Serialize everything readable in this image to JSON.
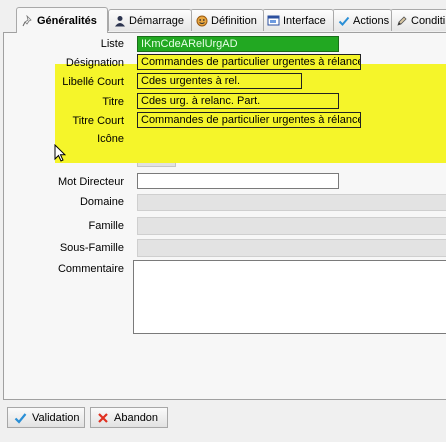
{
  "tabs": [
    {
      "label": "Généralités",
      "icon": "pushpin-icon",
      "active": true
    },
    {
      "label": "Démarrage",
      "icon": "person-icon",
      "active": false
    },
    {
      "label": "Définition",
      "icon": "face-icon",
      "active": false
    },
    {
      "label": "Interface",
      "icon": "window-icon",
      "active": false
    },
    {
      "label": "Actions",
      "icon": "checkmark-icon",
      "active": false
    },
    {
      "label": "Conditi",
      "icon": "pencil-icon",
      "active": false
    }
  ],
  "form": {
    "liste": {
      "label": "Liste",
      "value": "IKmCdeARelUrgAD"
    },
    "designation": {
      "label": "Désignation",
      "value": "Commandes de particulier urgentes à rélancer"
    },
    "libelle_court": {
      "label": "Libellé Court",
      "value": "Cdes urgentes à rel."
    },
    "titre": {
      "label": "Titre",
      "value": "Cdes urg. à relanc. Part."
    },
    "titre_court": {
      "label": "Titre Court",
      "value": "Commandes de particulier urgentes à rélancer"
    },
    "icone": {
      "label": "Icône"
    },
    "mot_directeur": {
      "label": "Mot Directeur",
      "value": ""
    },
    "domaine": {
      "label": "Domaine",
      "value": ""
    },
    "famille": {
      "label": "Famille",
      "value": ""
    },
    "sous_famille": {
      "label": "Sous-Famille",
      "value": ""
    },
    "commentaire": {
      "label": "Commentaire",
      "value": ""
    }
  },
  "buttons": {
    "validation": "Validation",
    "abandon": "Abandon"
  },
  "colors": {
    "highlight": "#f5f52a",
    "selected_field": "#22a822",
    "validation_icon": "#2a8fd6",
    "abandon_icon": "#e03020"
  }
}
